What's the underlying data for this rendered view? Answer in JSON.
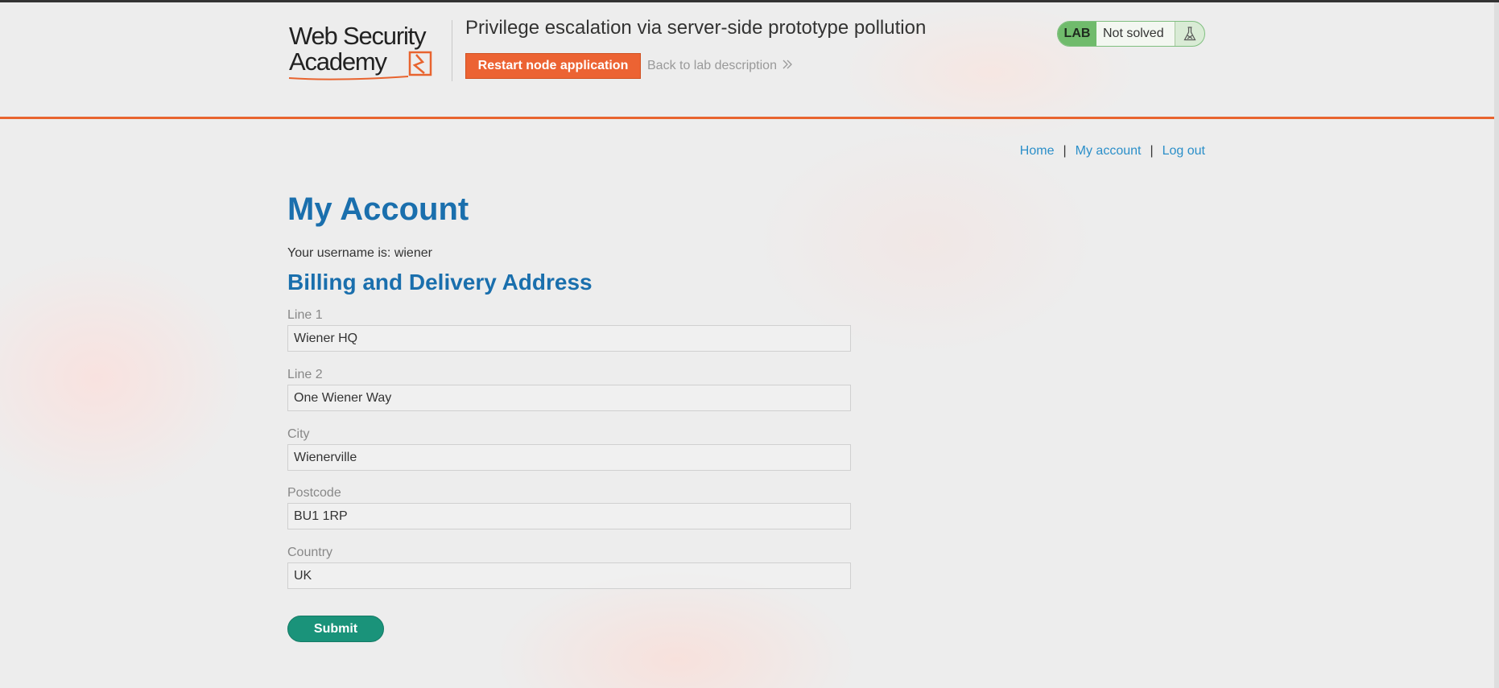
{
  "header": {
    "logo_text": "Web Security Academy",
    "lab_title": "Privilege escalation via server-side prototype pollution",
    "restart_label": "Restart node application",
    "back_label": "Back to lab description",
    "lab_badge": "LAB",
    "lab_state": "Not solved"
  },
  "nav": {
    "home": "Home",
    "account": "My account",
    "logout": "Log out",
    "separator": "|"
  },
  "page": {
    "heading": "My Account",
    "username_text": "Your username is: wiener",
    "subheading": "Billing and Delivery Address"
  },
  "form": {
    "line1_label": "Line 1",
    "line1_value": "Wiener HQ",
    "line2_label": "Line 2",
    "line2_value": "One Wiener Way",
    "city_label": "City",
    "city_value": "Wienerville",
    "postcode_label": "Postcode",
    "postcode_value": "BU1 1RP",
    "country_label": "Country",
    "country_value": "UK",
    "submit_label": "Submit"
  },
  "colors": {
    "accent_orange": "#ec6333",
    "link_blue": "#2b8fc9",
    "heading_blue": "#1a6fad",
    "submit_green": "#1a937a",
    "lab_green": "#70bb6c"
  }
}
